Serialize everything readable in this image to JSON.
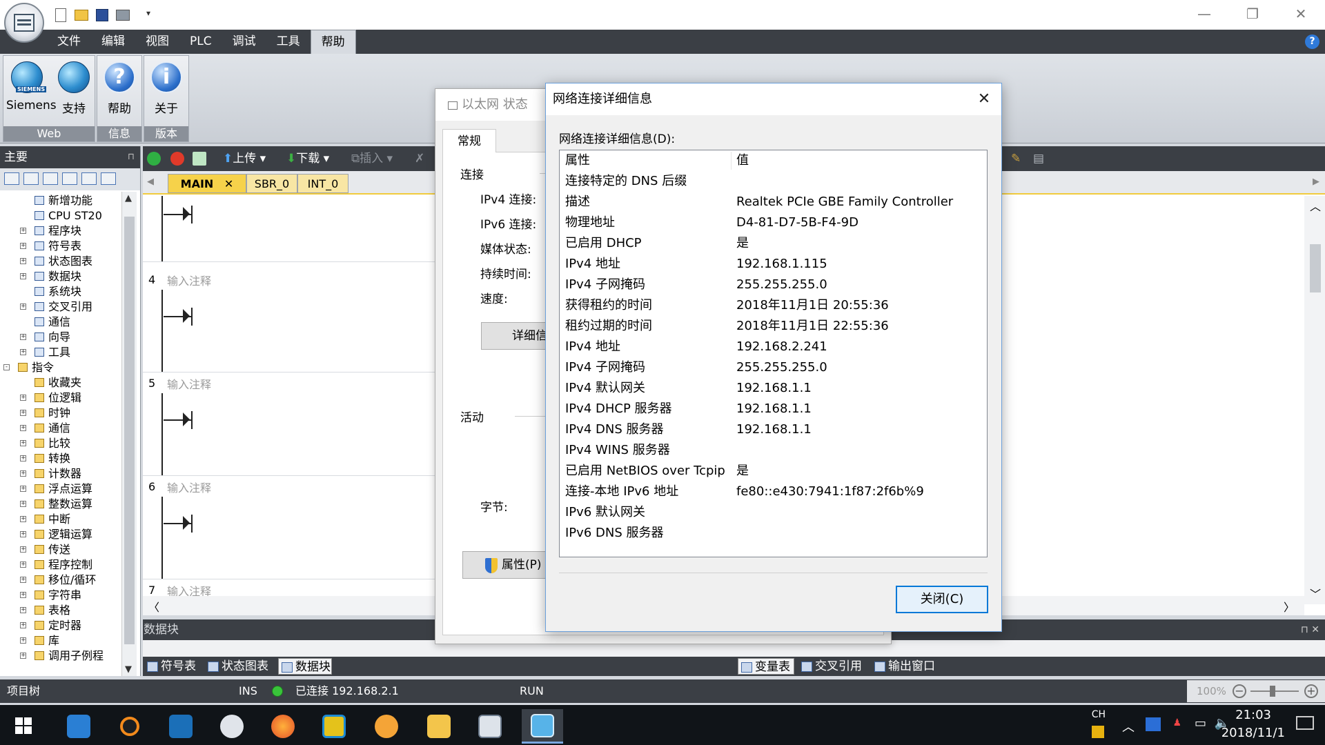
{
  "menubar": {
    "items": [
      "文件",
      "编辑",
      "视图",
      "PLC",
      "调试",
      "工具",
      "帮助"
    ],
    "active_index": 6
  },
  "ribbon": {
    "groups": [
      {
        "label": "Web",
        "buttons": [
          {
            "label": "Siemens",
            "icon": "siemens-globe-icon"
          },
          {
            "label": "支持",
            "icon": "support-globe-icon"
          }
        ]
      },
      {
        "label": "信息",
        "buttons": [
          {
            "label": "帮助",
            "icon": "help-icon"
          }
        ]
      },
      {
        "label": "版本",
        "buttons": [
          {
            "label": "关于",
            "icon": "info-icon"
          }
        ]
      }
    ],
    "siemens_tag": "SIEMENS"
  },
  "left_pane": {
    "title": "主要",
    "tree": [
      {
        "label": "新增功能",
        "level": 1,
        "expander": ""
      },
      {
        "label": "CPU ST20",
        "level": 1,
        "expander": ""
      },
      {
        "label": "程序块",
        "level": 1,
        "expander": "+"
      },
      {
        "label": "符号表",
        "level": 1,
        "expander": "+"
      },
      {
        "label": "状态图表",
        "level": 1,
        "expander": "+"
      },
      {
        "label": "数据块",
        "level": 1,
        "expander": "+"
      },
      {
        "label": "系统块",
        "level": 1,
        "expander": ""
      },
      {
        "label": "交叉引用",
        "level": 1,
        "expander": "+"
      },
      {
        "label": "通信",
        "level": 1,
        "expander": ""
      },
      {
        "label": "向导",
        "level": 1,
        "expander": "+"
      },
      {
        "label": "工具",
        "level": 1,
        "expander": "+"
      },
      {
        "label": "指令",
        "level": 0,
        "expander": "-"
      },
      {
        "label": "收藏夹",
        "level": 1,
        "expander": ""
      },
      {
        "label": "位逻辑",
        "level": 1,
        "expander": "+"
      },
      {
        "label": "时钟",
        "level": 1,
        "expander": "+"
      },
      {
        "label": "通信",
        "level": 1,
        "expander": "+"
      },
      {
        "label": "比较",
        "level": 1,
        "expander": "+"
      },
      {
        "label": "转换",
        "level": 1,
        "expander": "+"
      },
      {
        "label": "计数器",
        "level": 1,
        "expander": "+"
      },
      {
        "label": "浮点运算",
        "level": 1,
        "expander": "+"
      },
      {
        "label": "整数运算",
        "level": 1,
        "expander": "+"
      },
      {
        "label": "中断",
        "level": 1,
        "expander": "+"
      },
      {
        "label": "逻辑运算",
        "level": 1,
        "expander": "+"
      },
      {
        "label": "传送",
        "level": 1,
        "expander": "+"
      },
      {
        "label": "程序控制",
        "level": 1,
        "expander": "+"
      },
      {
        "label": "移位/循环",
        "level": 1,
        "expander": "+"
      },
      {
        "label": "字符串",
        "level": 1,
        "expander": "+"
      },
      {
        "label": "表格",
        "level": 1,
        "expander": "+"
      },
      {
        "label": "定时器",
        "level": 1,
        "expander": "+"
      },
      {
        "label": "库",
        "level": 1,
        "expander": "+"
      },
      {
        "label": "调用子例程",
        "level": 1,
        "expander": "+"
      }
    ]
  },
  "editor": {
    "toolbar": {
      "upload": "上传",
      "download": "下载",
      "insert": "插入"
    },
    "tabs": [
      {
        "label": "MAIN",
        "active": true
      },
      {
        "label": "SBR_0",
        "active": false
      },
      {
        "label": "INT_0",
        "active": false
      }
    ],
    "rungs": [
      {
        "number": "",
        "comment": ""
      },
      {
        "number": "4",
        "comment": "输入注释"
      },
      {
        "number": "5",
        "comment": "输入注释"
      },
      {
        "number": "6",
        "comment": "输入注释"
      },
      {
        "number": "7",
        "comment": "输入注释"
      }
    ]
  },
  "bottom_pane": {
    "title": "数据块",
    "left_tabs": [
      {
        "label": "符号表",
        "active": false
      },
      {
        "label": "状态图表",
        "active": false
      },
      {
        "label": "数据块",
        "active": true
      }
    ],
    "right_tabs": [
      {
        "label": "变量表",
        "active": true
      },
      {
        "label": "交叉引用",
        "active": false
      },
      {
        "label": "输出窗口",
        "active": false
      }
    ]
  },
  "status_bar": {
    "project_tree": "项目树",
    "ins": "INS",
    "connection": "已连接 192.168.2.1",
    "mode": "RUN",
    "zoom": "100%"
  },
  "taskbar": {
    "ime": "CH",
    "time": "21:03",
    "date": "2018/11/1"
  },
  "ethernet_dialog": {
    "title": "以太网 状态",
    "tab": "常规",
    "section_connection": "连接",
    "labels": [
      "IPv4 连接:",
      "IPv6 连接:",
      "媒体状态:",
      "持续时间:",
      "速度:"
    ],
    "details_button": "详细信",
    "section_activity": "活动",
    "bytes_label": "字节:",
    "properties_button": "属性(P)"
  },
  "details_dialog": {
    "title": "网络连接详细信息",
    "caption": "网络连接详细信息(D):",
    "header": {
      "property": "属性",
      "value": "值"
    },
    "rows": [
      {
        "property": "连接特定的 DNS 后缀",
        "value": ""
      },
      {
        "property": "描述",
        "value": "Realtek PCIe GBE Family Controller"
      },
      {
        "property": "物理地址",
        "value": "D4-81-D7-5B-F4-9D"
      },
      {
        "property": "已启用 DHCP",
        "value": "是"
      },
      {
        "property": "IPv4 地址",
        "value": "192.168.1.115"
      },
      {
        "property": "IPv4 子网掩码",
        "value": "255.255.255.0"
      },
      {
        "property": "获得租约的时间",
        "value": "2018年11月1日 20:55:36"
      },
      {
        "property": "租约过期的时间",
        "value": "2018年11月1日 22:55:36"
      },
      {
        "property": "IPv4 地址",
        "value": "192.168.2.241"
      },
      {
        "property": "IPv4 子网掩码",
        "value": "255.255.255.0"
      },
      {
        "property": "IPv4 默认网关",
        "value": "192.168.1.1"
      },
      {
        "property": "IPv4 DHCP 服务器",
        "value": "192.168.1.1"
      },
      {
        "property": "IPv4 DNS 服务器",
        "value": "192.168.1.1"
      },
      {
        "property": "IPv4 WINS 服务器",
        "value": ""
      },
      {
        "property": "已启用 NetBIOS over Tcpip",
        "value": "是"
      },
      {
        "property": "连接-本地 IPv6 地址",
        "value": "fe80::e430:7941:1f87:2f6b%9"
      },
      {
        "property": "IPv6 默认网关",
        "value": ""
      },
      {
        "property": "IPv6 DNS 服务器",
        "value": ""
      }
    ],
    "close_button": "关闭(C)"
  }
}
